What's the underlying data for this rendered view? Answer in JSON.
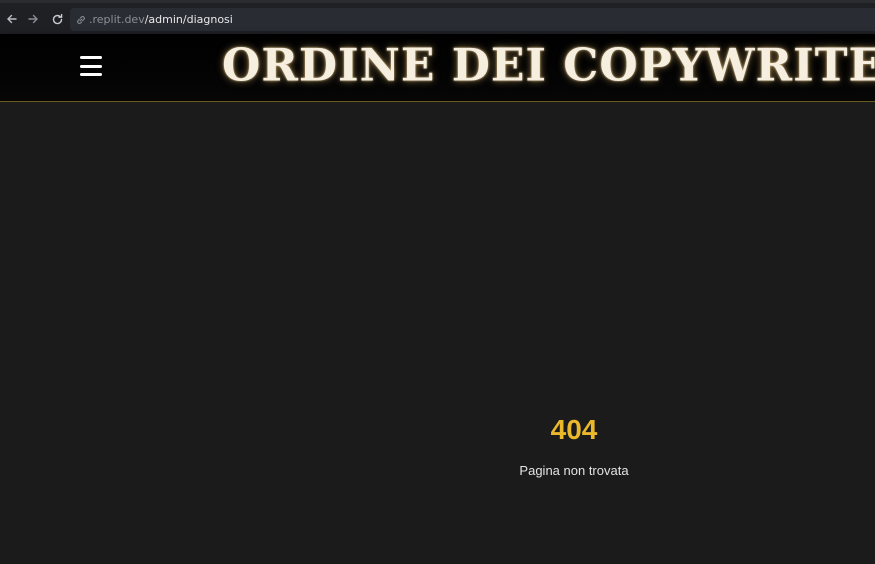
{
  "browser": {
    "url_host": ".replit.dev",
    "url_path": "/admin/diagnosi",
    "back_icon": "arrow-left-icon",
    "forward_icon": "arrow-right-icon",
    "reload_icon": "reload-icon"
  },
  "header": {
    "title": "ORDINE DEI COPYWRITER ESTINTI",
    "menu_icon": "hamburger-menu-icon"
  },
  "error": {
    "code": "404",
    "message": "Pagina non trovata"
  },
  "colors": {
    "accent": "#e9b92b",
    "background": "#1b1b1b",
    "header_border": "#6b5a1e"
  }
}
